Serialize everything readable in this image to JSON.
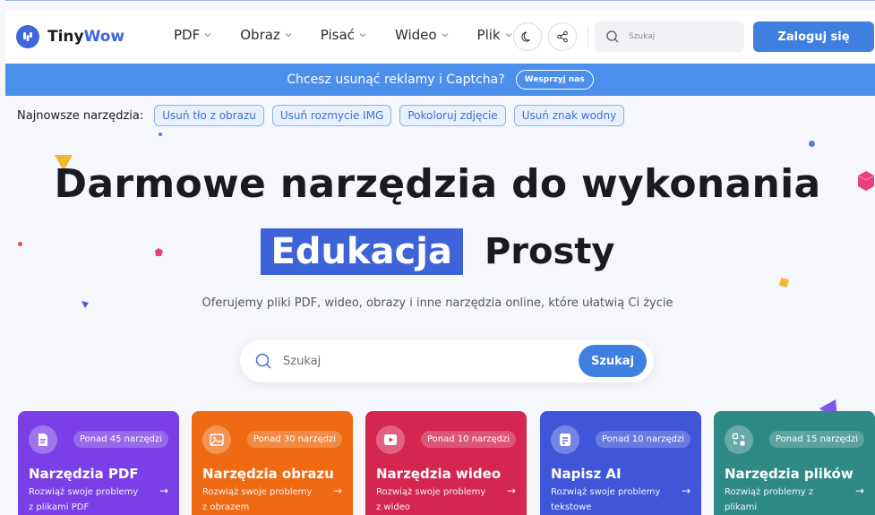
{
  "header": {
    "logo_prefix": "Tiny",
    "logo_accent": "Wow",
    "nav": [
      "PDF",
      "Obraz",
      "Pisać",
      "Wideo",
      "Plik"
    ],
    "search_placeholder": "Szukaj",
    "login_label": "Zaloguj się"
  },
  "promo": {
    "text": "Chcesz usunąć reklamy i Captcha?",
    "button": "Wesprzyj nas"
  },
  "recent": {
    "label": "Najnowsze narzędzia:",
    "chips": [
      "Usuń tło z obrazu",
      "Usuń rozmycie IMG",
      "Pokoloruj zdjęcie",
      "Usuń znak wodny"
    ]
  },
  "hero": {
    "title": "Darmowe narzędzia do wykonania",
    "highlight": "Edukacja",
    "plain": "Prosty",
    "subtitle": "Oferujemy pliki PDF, wideo, obrazy i inne narzędzia online, które ułatwią Ci życie",
    "search_placeholder": "Szukaj",
    "search_button": "Szukaj"
  },
  "cards": [
    {
      "title": "Narzędzia PDF",
      "badge": "Ponad 45 narzędzi",
      "desc": "Rozwiąż swoje problemy z plikami PDF",
      "color": "#7a3fe6",
      "icon": "pdf-file-icon"
    },
    {
      "title": "Narzędzia obrazu",
      "badge": "Ponad 30 narzędzi",
      "desc": "Rozwiąż swoje problemy z obrazem",
      "color": "#ef6a12",
      "icon": "image-icon"
    },
    {
      "title": "Narzędzia wideo",
      "badge": "Ponad 10 narzędzi",
      "desc": "Rozwiąż swoje problemy z wideo",
      "color": "#d4264f",
      "icon": "video-icon"
    },
    {
      "title": "Napisz AI",
      "badge": "Ponad 10 narzędzi",
      "desc": "Rozwiąż swoje problemy tekstowe",
      "color": "#3f56d8",
      "icon": "document-text-icon"
    },
    {
      "title": "Narzędzia plików",
      "badge": "Ponad 15 narzędzi",
      "desc": "Rozwiąż problemy z plikami",
      "color": "#2f8a86",
      "icon": "file-convert-icon"
    }
  ],
  "arrow_glyph": "→"
}
